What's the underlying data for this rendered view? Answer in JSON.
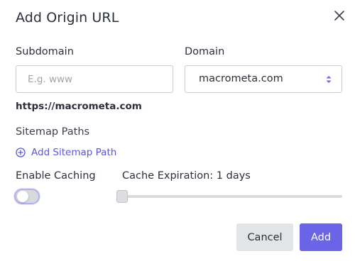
{
  "dialog": {
    "title": "Add Origin URL",
    "close_icon": "close-icon"
  },
  "subdomain": {
    "label": "Subdomain",
    "value": "",
    "placeholder": "E.g. www"
  },
  "domain": {
    "label": "Domain",
    "selected": "macrometa.com",
    "icon": "chevron-up-down-icon"
  },
  "preview_url": "https://macrometa.com",
  "sitemap": {
    "label": "Sitemap Paths",
    "add_label": "Add Sitemap Path",
    "add_icon": "plus-circle-icon"
  },
  "caching": {
    "enable_label": "Enable Caching",
    "enabled": false,
    "expiration_label": "Cache Expiration: 1 days",
    "expiration_days": 1
  },
  "actions": {
    "cancel_label": "Cancel",
    "add_label": "Add"
  },
  "colors": {
    "accent": "#6b64e6",
    "link": "#5b55d6",
    "cancel_bg": "#e3e4e7"
  }
}
